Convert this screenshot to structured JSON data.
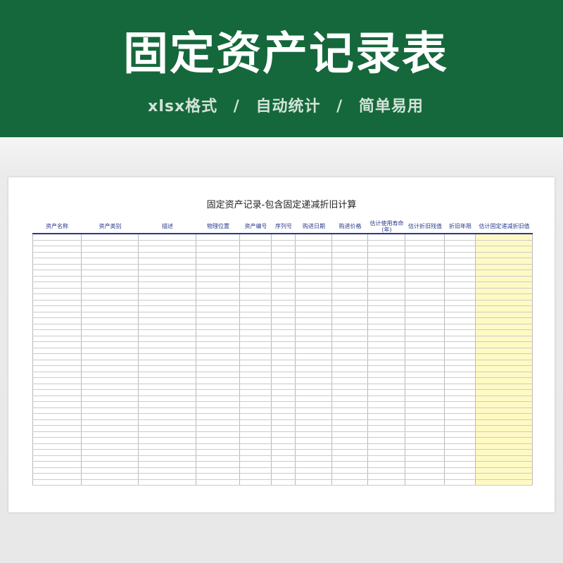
{
  "banner": {
    "title": "固定资产记录表",
    "subtitle": "xlsx格式 / 自动统计 / 简单易用"
  },
  "sheet": {
    "title": "固定资产记录-包含固定递减折旧计算",
    "columns": [
      "资产名称",
      "资产类别",
      "描述",
      "物理位置",
      "资产编号",
      "序列号",
      "购进日期",
      "购进价格",
      "估计使用寿命\n(年)",
      "估计折旧残值",
      "折旧年限",
      "估计固定递减折旧值"
    ]
  },
  "colors": {
    "banner": "#15683b",
    "header_text": "#27398c",
    "highlight_column": "#fffac4"
  }
}
